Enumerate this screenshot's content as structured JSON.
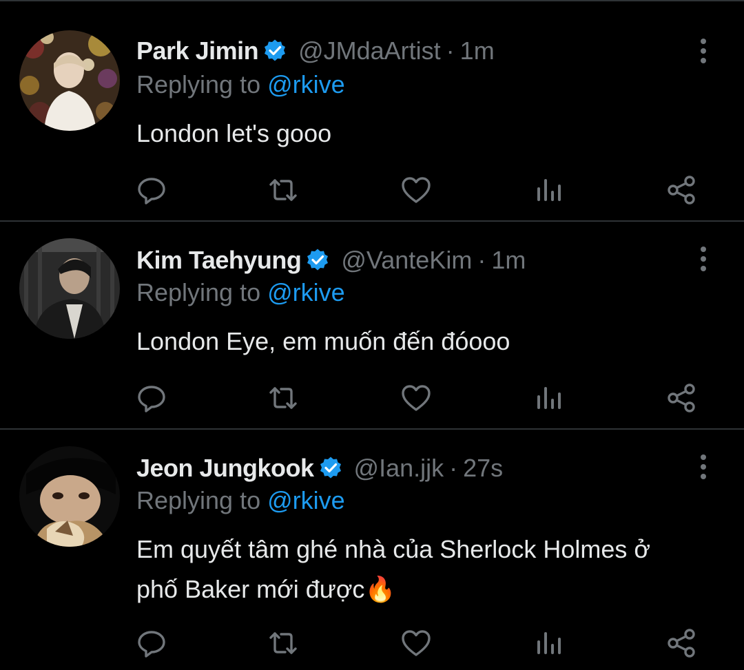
{
  "colors": {
    "background": "#000000",
    "text_primary": "#e7e9ea",
    "text_secondary": "#71767b",
    "accent": "#1d9bf0",
    "separator": "#2f3336"
  },
  "icons": {
    "verified": "verified-badge-icon",
    "more": "more-vertical-icon",
    "reply": "reply-icon",
    "retweet": "retweet-icon",
    "like": "heart-icon",
    "views": "views-chart-icon",
    "share": "share-icon"
  },
  "tweets": [
    {
      "name": "Park Jimin",
      "handle": "@JMdaArtist",
      "separator": "·",
      "time": "1m",
      "replying_prefix": "Replying to",
      "replying_to": "@rkive",
      "text": "London let's gooo"
    },
    {
      "name": "Kim Taehyung",
      "handle": "@VanteKim",
      "separator": "·",
      "time": "1m",
      "replying_prefix": "Replying to",
      "replying_to": "@rkive",
      "text": "London Eye, em muốn đến đóooo"
    },
    {
      "name": "Jeon Jungkook",
      "handle": "@Ian.jjk",
      "separator": "·",
      "time": "27s",
      "replying_prefix": "Replying to",
      "replying_to": "@rkive",
      "text_line1": "Em quyết tâm ghé nhà của Sherlock Holmes ở",
      "text_line2": "phố Baker mới được",
      "emoji": "🔥"
    }
  ]
}
